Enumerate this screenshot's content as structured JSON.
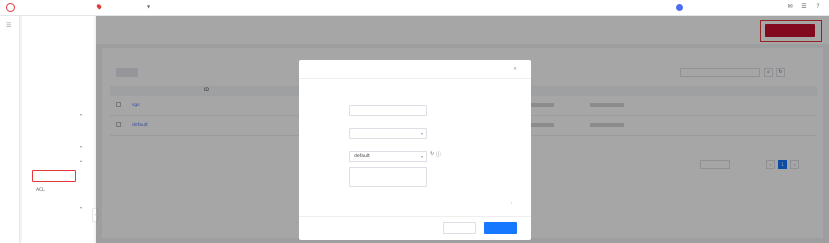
{
  "topbar": {
    "logo_text": "",
    "console_label": "",
    "region": "",
    "lang": "",
    "account": ""
  },
  "sidebar": {
    "title": "",
    "items": [
      {
        "label": ""
      },
      {
        "label": ""
      },
      {
        "label": ""
      },
      {
        "label": ""
      },
      {
        "label": ""
      },
      {
        "label": ""
      },
      {
        "label": ""
      },
      {
        "label": ""
      }
    ],
    "active_item": "",
    "sub_item": "ACL",
    "items_after": [
      {
        "label": ""
      },
      {
        "label": ""
      }
    ]
  },
  "page": {
    "title": "",
    "create_button": "",
    "hint": "",
    "search_placeholder": ""
  },
  "table": {
    "columns": [
      "",
      "ID",
      "",
      "",
      "",
      ""
    ],
    "rows": [
      {
        "name": "sgs",
        "id": "",
        "count": ""
      },
      {
        "name": "default",
        "id": "",
        "count": ""
      }
    ],
    "action_labels": [
      "",
      "",
      ""
    ]
  },
  "pager": {
    "page_size": "",
    "total": "",
    "current_page": "1"
  },
  "modal": {
    "title": "",
    "description": "",
    "fields": {
      "name_label": "",
      "name_value": "",
      "template_label": "",
      "template_value": "",
      "project_label": "",
      "project_value": "default",
      "desc_label": "",
      "desc_placeholder": ""
    },
    "advanced_link": "",
    "cancel": "",
    "ok": ""
  },
  "watermark": ""
}
